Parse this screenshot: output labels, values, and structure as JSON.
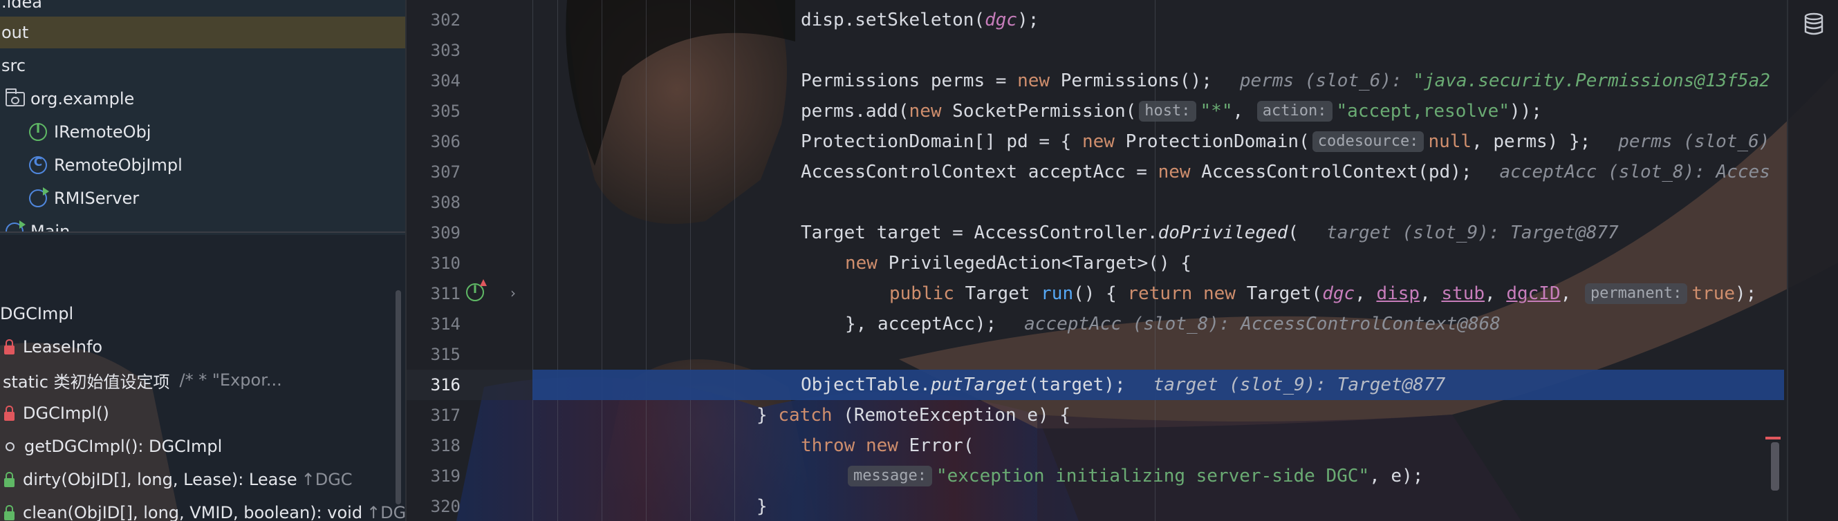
{
  "project_tree": {
    "items": [
      {
        "label": ".idea",
        "icon": "none"
      },
      {
        "label": "out",
        "icon": "none"
      },
      {
        "label": "src",
        "icon": "none"
      },
      {
        "label": "org.example",
        "icon": "package-icon"
      },
      {
        "label": "IRemoteObj",
        "icon": "interface-icon"
      },
      {
        "label": "RemoteObjImpl",
        "icon": "class-icon"
      },
      {
        "label": "RMIServer",
        "icon": "runnable-class-icon"
      },
      {
        "label": "Main",
        "icon": "runnable-class-icon"
      }
    ]
  },
  "structure": {
    "title": "DGCImpl",
    "items": [
      {
        "label": "LeaseInfo",
        "icon": "private-lock-icon",
        "extra": ""
      },
      {
        "label": "static 类初始值设定项",
        "icon": "none",
        "extra": "/*         * \"Expor..."
      },
      {
        "label": "DGCImpl()",
        "icon": "private-lock-icon",
        "extra": ""
      },
      {
        "label": "getDGCImpl(): DGCImpl",
        "icon": "method-icon",
        "extra": ""
      },
      {
        "label": "dirty(ObjID[], long, Lease): Lease",
        "icon": "public-lock-icon",
        "extra": "↑DGC"
      },
      {
        "label": "clean(ObjID[], long, VMID, boolean): void",
        "icon": "public-lock-icon",
        "extra": "↑DGC"
      }
    ]
  },
  "editor": {
    "current_line": "316",
    "lines": [
      {
        "num": "302",
        "t1": "disp.setSkeleton(",
        "v1": "dgc",
        "t2": ");"
      },
      {
        "num": "303"
      },
      {
        "num": "304",
        "t1": "Permissions perms = ",
        "k1": "new",
        "t2": " Permissions();",
        "hint": "perms (slot_6): ",
        "hintval": "\"java.security.Permissions@13f5a2"
      },
      {
        "num": "305",
        "t1": "perms.add(",
        "k1": "new",
        "t2": " SocketPermission(",
        "p1": "host:",
        "s1": "\"*\"",
        "t3": ", ",
        "p2": "action:",
        "s2": "\"accept,resolve\"",
        "t4": "));"
      },
      {
        "num": "306",
        "t1": "ProtectionDomain[] pd = { ",
        "k1": "new",
        "t2": " ProtectionDomain(",
        "p1": "codesource:",
        "k2": "null",
        "t3": ", perms) };",
        "hint": "perms (slot_6)"
      },
      {
        "num": "307",
        "t1": "AccessControlContext acceptAcc = ",
        "k1": "new",
        "t2": " AccessControlContext(pd);",
        "hint": "acceptAcc (slot_8): Acces"
      },
      {
        "num": "308"
      },
      {
        "num": "309",
        "t1": "Target target = AccessController.",
        "m1": "doPrivileged",
        "t2": "(",
        "hint": "target (slot_9): Target@877"
      },
      {
        "num": "310",
        "k1": "new",
        "t1": " PrivilegedAction<Target>() {"
      },
      {
        "num": "311",
        "k1": "public",
        "t1": " Target ",
        "m1": "run",
        "t2": "() { ",
        "k2": "return",
        "k3": "new",
        "t3": " Target(",
        "v1": "dgc",
        "c1": ", ",
        "v2": "disp",
        "c2": ", ",
        "v3": "stub",
        "c3": ", ",
        "v4": "dgcID",
        "c4": ", ",
        "p1": "permanent:",
        "k4": "true",
        "t4": ");"
      },
      {
        "num": "314",
        "t1": "}, acceptAcc);",
        "hint": "acceptAcc (slot_8): AccessControlContext@868"
      },
      {
        "num": "315"
      },
      {
        "num": "316",
        "t1": "ObjectTable.",
        "m1": "putTarget",
        "t2": "(target);",
        "hint": "target (slot_9): Target@877"
      },
      {
        "num": "317",
        "t1": "} ",
        "k1": "catch",
        "t2": " (RemoteException e) {"
      },
      {
        "num": "318",
        "k1": "throw",
        "k2": "new",
        "t1": " Error("
      },
      {
        "num": "319",
        "p1": "message:",
        "s1": "\"exception initializing server-side DGC\"",
        "t1": ", e);"
      },
      {
        "num": "320",
        "t1": "}"
      }
    ]
  },
  "colors": {
    "editor_bg": "#1f2127",
    "current_line": "#214283",
    "keyword": "#cf8e6d",
    "string": "#6aab73",
    "field": "#c77dbb",
    "method": "#56a8f5",
    "selected_tree_row": "#695828"
  },
  "right_toolbar": {
    "icon": "database-icon"
  }
}
